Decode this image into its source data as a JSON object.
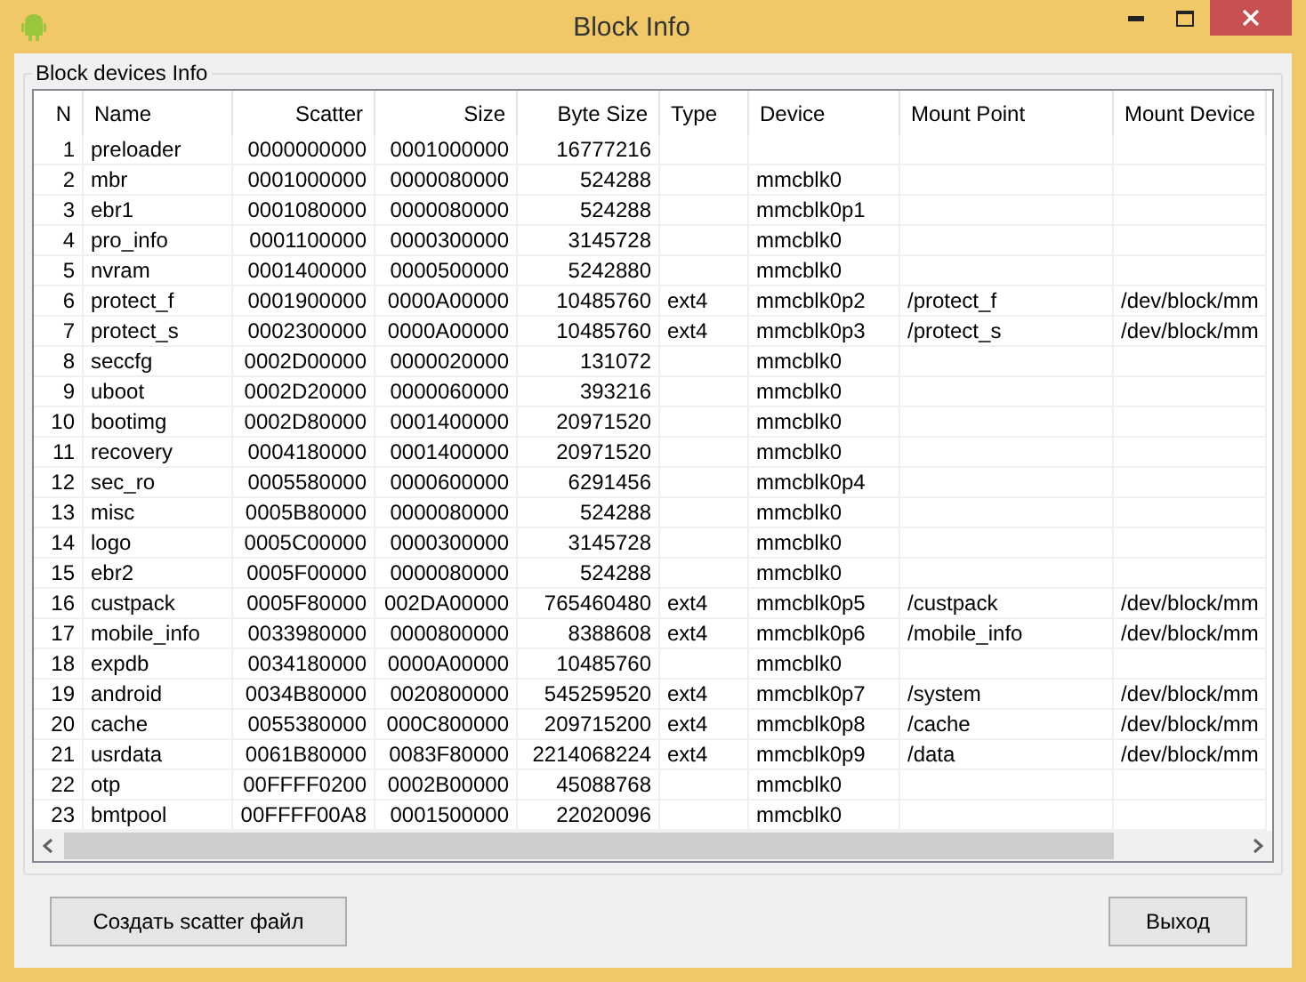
{
  "window": {
    "title": "Block Info"
  },
  "group": {
    "title": "Block devices Info"
  },
  "table": {
    "columns": [
      "N",
      "Name",
      "Scatter",
      "Size",
      "Byte Size",
      "Type",
      "Device",
      "Mount Point",
      "Mount Device"
    ],
    "rows": [
      {
        "n": "1",
        "name": "preloader",
        "scatter": "0000000000",
        "size": "0001000000",
        "byte_size": "16777216"
      },
      {
        "n": "2",
        "name": "mbr",
        "scatter": "0001000000",
        "size": "0000080000",
        "byte_size": "524288",
        "device": "mmcblk0"
      },
      {
        "n": "3",
        "name": "ebr1",
        "scatter": "0001080000",
        "size": "0000080000",
        "byte_size": "524288",
        "device": "mmcblk0p1"
      },
      {
        "n": "4",
        "name": "pro_info",
        "scatter": "0001100000",
        "size": "0000300000",
        "byte_size": "3145728",
        "device": "mmcblk0"
      },
      {
        "n": "5",
        "name": "nvram",
        "scatter": "0001400000",
        "size": "0000500000",
        "byte_size": "5242880",
        "device": "mmcblk0"
      },
      {
        "n": "6",
        "name": "protect_f",
        "scatter": "0001900000",
        "size": "0000A00000",
        "byte_size": "10485760",
        "type": "ext4",
        "device": "mmcblk0p2",
        "mount_point": "/protect_f",
        "mount_device": "/dev/block/mm"
      },
      {
        "n": "7",
        "name": "protect_s",
        "scatter": "0002300000",
        "size": "0000A00000",
        "byte_size": "10485760",
        "type": "ext4",
        "device": "mmcblk0p3",
        "mount_point": "/protect_s",
        "mount_device": "/dev/block/mm"
      },
      {
        "n": "8",
        "name": "seccfg",
        "scatter": "0002D00000",
        "size": "0000020000",
        "byte_size": "131072",
        "device": "mmcblk0"
      },
      {
        "n": "9",
        "name": "uboot",
        "scatter": "0002D20000",
        "size": "0000060000",
        "byte_size": "393216",
        "device": "mmcblk0"
      },
      {
        "n": "10",
        "name": "bootimg",
        "scatter": "0002D80000",
        "size": "0001400000",
        "byte_size": "20971520",
        "device": "mmcblk0"
      },
      {
        "n": "11",
        "name": "recovery",
        "scatter": "0004180000",
        "size": "0001400000",
        "byte_size": "20971520",
        "device": "mmcblk0"
      },
      {
        "n": "12",
        "name": "sec_ro",
        "scatter": "0005580000",
        "size": "0000600000",
        "byte_size": "6291456",
        "device": "mmcblk0p4"
      },
      {
        "n": "13",
        "name": "misc",
        "scatter": "0005B80000",
        "size": "0000080000",
        "byte_size": "524288",
        "device": "mmcblk0"
      },
      {
        "n": "14",
        "name": "logo",
        "scatter": "0005C00000",
        "size": "0000300000",
        "byte_size": "3145728",
        "device": "mmcblk0"
      },
      {
        "n": "15",
        "name": "ebr2",
        "scatter": "0005F00000",
        "size": "0000080000",
        "byte_size": "524288",
        "device": "mmcblk0"
      },
      {
        "n": "16",
        "name": "custpack",
        "scatter": "0005F80000",
        "size": "002DA00000",
        "byte_size": "765460480",
        "type": "ext4",
        "device": "mmcblk0p5",
        "mount_point": "/custpack",
        "mount_device": "/dev/block/mm"
      },
      {
        "n": "17",
        "name": "mobile_info",
        "scatter": "0033980000",
        "size": "0000800000",
        "byte_size": "8388608",
        "type": "ext4",
        "device": "mmcblk0p6",
        "mount_point": "/mobile_info",
        "mount_device": "/dev/block/mm"
      },
      {
        "n": "18",
        "name": "expdb",
        "scatter": "0034180000",
        "size": "0000A00000",
        "byte_size": "10485760",
        "device": "mmcblk0"
      },
      {
        "n": "19",
        "name": "android",
        "scatter": "0034B80000",
        "size": "0020800000",
        "byte_size": "545259520",
        "type": "ext4",
        "device": "mmcblk0p7",
        "mount_point": "/system",
        "mount_device": "/dev/block/mm"
      },
      {
        "n": "20",
        "name": "cache",
        "scatter": "0055380000",
        "size": "000C800000",
        "byte_size": "209715200",
        "type": "ext4",
        "device": "mmcblk0p8",
        "mount_point": "/cache",
        "mount_device": "/dev/block/mm"
      },
      {
        "n": "21",
        "name": "usrdata",
        "scatter": "0061B80000",
        "size": "0083F80000",
        "byte_size": "2214068224",
        "type": "ext4",
        "device": "mmcblk0p9",
        "mount_point": "/data",
        "mount_device": "/dev/block/mm"
      },
      {
        "n": "22",
        "name": "otp",
        "scatter": "00FFFF0200",
        "size": "0002B00000",
        "byte_size": "45088768",
        "device": "mmcblk0"
      },
      {
        "n": "23",
        "name": "bmtpool",
        "scatter": "00FFFF00A8",
        "size": "0001500000",
        "byte_size": "22020096",
        "device": "mmcblk0"
      }
    ]
  },
  "buttons": [
    "Создать scatter файл",
    "Выход"
  ]
}
